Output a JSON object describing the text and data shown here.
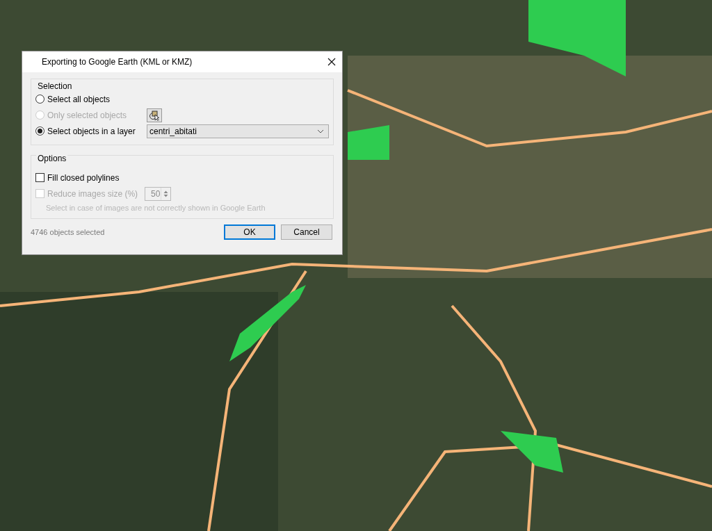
{
  "dialog": {
    "title": "Exporting to Google Earth (KML or KMZ)",
    "selection": {
      "legend": "Selection",
      "options": [
        {
          "kind": "plain",
          "label": "Select all objects",
          "selected": false,
          "disabled": false
        },
        {
          "kind": "pick",
          "label": "Only selected objects",
          "selected": false,
          "disabled": true
        },
        {
          "kind": "layer",
          "label": "Select objects in a layer",
          "selected": true,
          "disabled": false,
          "value": "centri_abitati"
        }
      ]
    },
    "options": {
      "legend": "Options",
      "items": [
        {
          "kind": "plain",
          "label": "Fill closed polylines",
          "checked": false,
          "disabled": false
        },
        {
          "kind": "spin",
          "label": "Reduce images size (%)",
          "checked": false,
          "disabled": true,
          "value": "50",
          "hint": "Select in case of images are not correctly shown in Google Earth"
        }
      ]
    },
    "status": "4746 objects selected",
    "buttons": [
      {
        "label": "OK",
        "default": true
      },
      {
        "label": "Cancel",
        "default": false
      }
    ]
  }
}
